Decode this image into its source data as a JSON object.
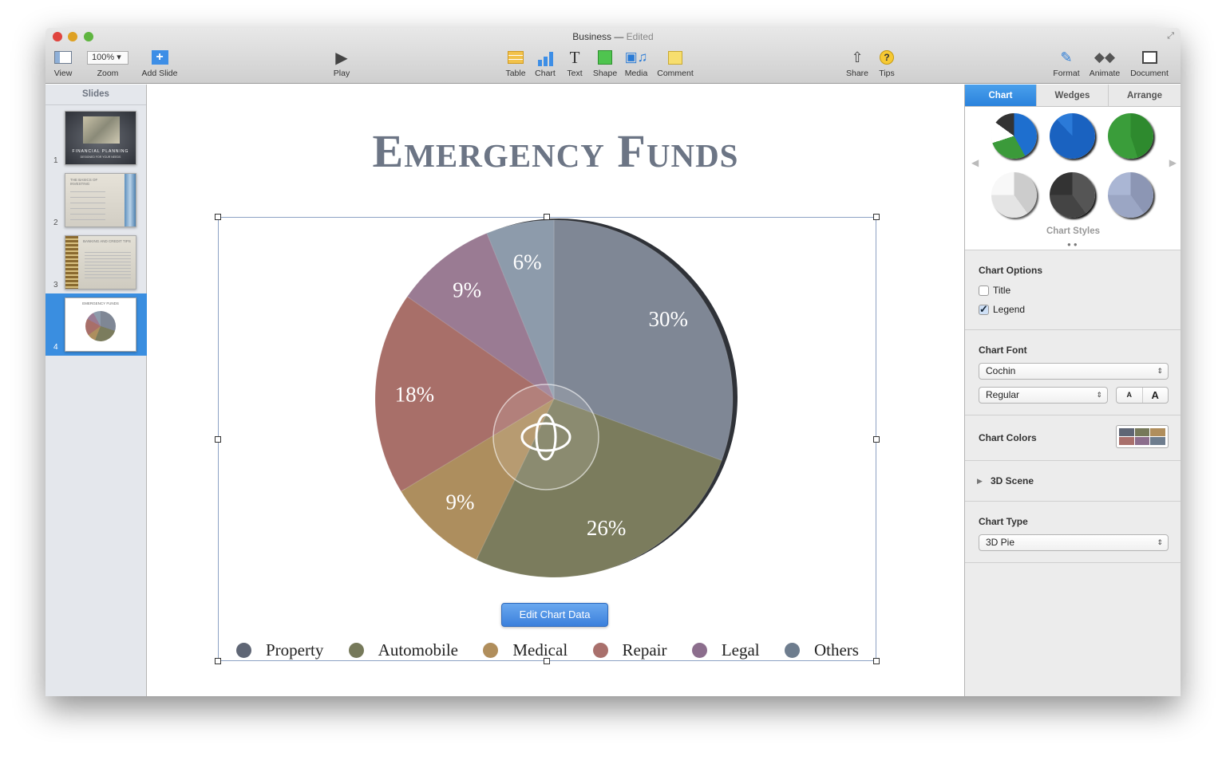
{
  "window": {
    "title": "Business",
    "status": "Edited"
  },
  "toolbar": {
    "view": "View",
    "zoom": "Zoom",
    "zoom_value": "100%",
    "add_slide": "Add Slide",
    "play": "Play",
    "table": "Table",
    "chart": "Chart",
    "text": "Text",
    "shape": "Shape",
    "media": "Media",
    "comment": "Comment",
    "share": "Share",
    "tips": "Tips",
    "format": "Format",
    "animate": "Animate",
    "document": "Document"
  },
  "sidebar": {
    "header": "Slides",
    "slides": [
      {
        "number": "1",
        "title": "Financial Planning",
        "subtitle": "Designed for your needs"
      },
      {
        "number": "2",
        "title": "The Basics of Investing"
      },
      {
        "number": "3",
        "title": "Banking and Credit Tips"
      },
      {
        "number": "4",
        "title": "Emergency Funds",
        "selected": true
      }
    ]
  },
  "slide": {
    "title": "Emergency Funds",
    "edit_chart_button": "Edit Chart Data"
  },
  "chart_data": {
    "type": "pie",
    "style": "3D Pie",
    "categories": [
      "Property",
      "Automobile",
      "Medical",
      "Repair",
      "Legal",
      "Others"
    ],
    "values": [
      30,
      26,
      9,
      18,
      9,
      6
    ],
    "labels": [
      "30%",
      "26%",
      "9%",
      "18%",
      "9%",
      "6%"
    ],
    "colors": [
      "#7f8795",
      "#7b7c5d",
      "#ad8e5e",
      "#a86f69",
      "#9a7b93",
      "#8d9bab"
    ],
    "legend_colors": [
      "#5f6675",
      "#76795a",
      "#b08e5c",
      "#a9706c",
      "#8c6e8d",
      "#6e7d8e"
    ],
    "legend": "bottom"
  },
  "inspector": {
    "tabs": [
      "Chart",
      "Wedges",
      "Arrange"
    ],
    "chart_styles_label": "Chart Styles",
    "chart_options": {
      "label": "Chart Options",
      "title": "Title",
      "title_checked": false,
      "legend": "Legend",
      "legend_checked": true
    },
    "chart_font": {
      "label": "Chart Font",
      "family": "Cochin",
      "style": "Regular",
      "smaller": "A",
      "larger": "A"
    },
    "chart_colors": {
      "label": "Chart Colors"
    },
    "scene": {
      "label": "3D Scene"
    },
    "chart_type": {
      "label": "Chart Type",
      "value": "3D Pie"
    }
  }
}
